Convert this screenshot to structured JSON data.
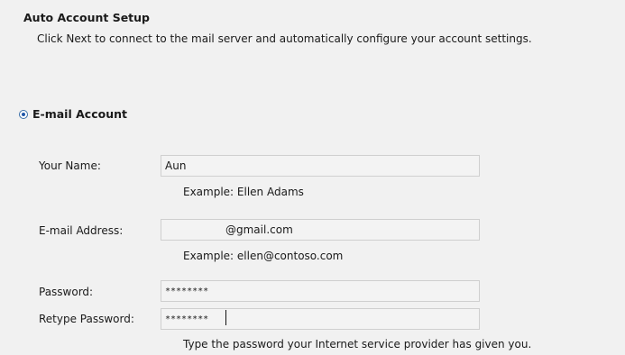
{
  "header": {
    "title": "Auto Account Setup",
    "description": "Click Next to connect to the mail server and automatically configure your account settings."
  },
  "account_type": {
    "label": "E-mail Account",
    "selected": true
  },
  "form": {
    "name": {
      "label": "Your Name:",
      "value": "Aun",
      "hint": "Example: Ellen Adams"
    },
    "email": {
      "label": "E-mail Address:",
      "value": "@gmail.com",
      "hint": "Example: ellen@contoso.com"
    },
    "password": {
      "label": "Password:",
      "value": "********"
    },
    "retype_password": {
      "label": "Retype Password:",
      "value": "********"
    },
    "password_hint": "Type the password your Internet service provider has given you."
  }
}
